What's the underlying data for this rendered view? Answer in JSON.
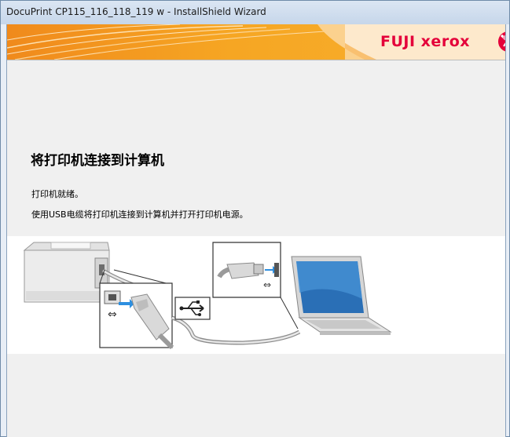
{
  "window": {
    "title": "DocuPrint CP115_116_118_119 w - InstallShield Wizard"
  },
  "banner": {
    "logo_text": "FUJI xerox",
    "logo_icon": "xerox-sphere-icon",
    "colors": {
      "orange": "#f5a21f",
      "brand_red": "#e4003a"
    }
  },
  "main": {
    "heading": "将打印机连接到计算机",
    "status_text": "打印机就绪。",
    "instruction_text": "使用USB电缆将打印机连接到计算机并打开打印机电源。"
  },
  "illustration": {
    "icons": [
      "printer-icon",
      "usb-b-connector-icon",
      "usb-symbol-icon",
      "usb-a-connector-icon",
      "laptop-icon"
    ]
  }
}
